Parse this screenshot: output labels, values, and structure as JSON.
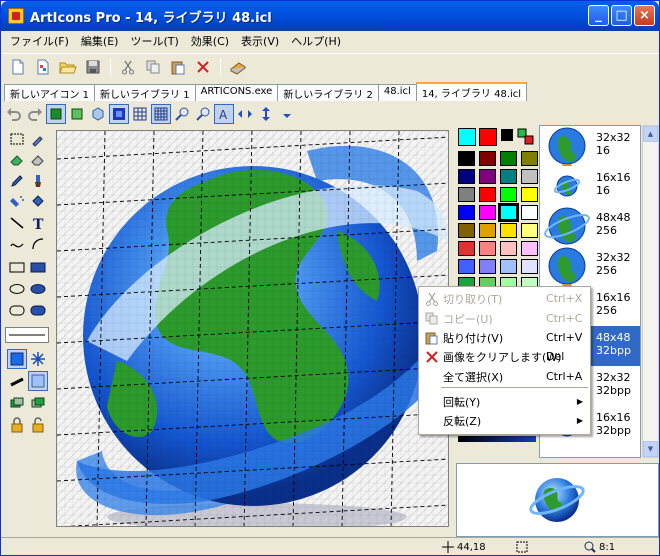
{
  "window": {
    "title": "ArtIcons Pro - 14, ライブラリ 48.icl",
    "buttons": {
      "minimize": "_",
      "maximize": "□",
      "close": "×"
    }
  },
  "menu": [
    "ファイル(F)",
    "編集(E)",
    "ツール(T)",
    "効果(C)",
    "表示(V)",
    "ヘルプ(H)"
  ],
  "tabs": [
    "新しいアイコン 1",
    "新しいライブラリ 1",
    "ARTICONS.exe",
    "新しいライブラリ 2",
    "48.icl",
    "14, ライブラリ 48.icl"
  ],
  "active_tab": 5,
  "context_menu": {
    "items": [
      {
        "label": "切り取り(T)",
        "shortcut": "Ctrl+X",
        "enabled": false,
        "icon": "scissors-icon"
      },
      {
        "label": "コピー(U)",
        "shortcut": "Ctrl+C",
        "enabled": false,
        "icon": "copy-icon"
      },
      {
        "label": "貼り付け(V)",
        "shortcut": "Ctrl+V",
        "enabled": true,
        "icon": "paste-icon"
      },
      {
        "label": "画像をクリアします(W)",
        "shortcut": "Del",
        "enabled": true,
        "icon": "clear-icon"
      },
      {
        "label": "全て選択(X)",
        "shortcut": "Ctrl+A",
        "enabled": true,
        "icon": ""
      },
      {
        "label": "回転(Y)",
        "shortcut": "",
        "enabled": true,
        "submenu": true
      },
      {
        "label": "反転(Z)",
        "shortcut": "",
        "enabled": true,
        "submenu": true
      }
    ]
  },
  "icon_list": [
    {
      "label": "32x32\n16",
      "selected": false
    },
    {
      "label": "16x16\n16",
      "selected": false
    },
    {
      "label": "48x48\n256",
      "selected": false
    },
    {
      "label": "32x32\n256",
      "selected": false
    },
    {
      "label": "16x16\n256",
      "selected": false
    },
    {
      "label": "48x48\n32bpp",
      "selected": true
    },
    {
      "label": "32x32\n32bpp",
      "selected": false
    },
    {
      "label": "16x16\n32bpp",
      "selected": false
    }
  ],
  "palette_colors": [
    "#000000",
    "#800000",
    "#008000",
    "#808000",
    "#000080",
    "#800080",
    "#008080",
    "#c0c0c0",
    "#808080",
    "#ff0000",
    "#00ff00",
    "#ffff00",
    "#0000ff",
    "#ff00ff",
    "#00ffff",
    "#ffffff",
    "#806000",
    "#e0a000",
    "#ffe000",
    "#ffff80",
    "#e03030",
    "#ff8080",
    "#ffc0c0",
    "#ffc0ff",
    "#4060ff",
    "#8080ff",
    "#a0c0ff",
    "#e0e0ff",
    "#20a040",
    "#60d060",
    "#a0ffa0",
    "#c0ffc0"
  ],
  "foreground_color": "#00ffff",
  "background_color": "#ff0000",
  "status": {
    "coords": "44,18",
    "zoom": "8:1"
  }
}
